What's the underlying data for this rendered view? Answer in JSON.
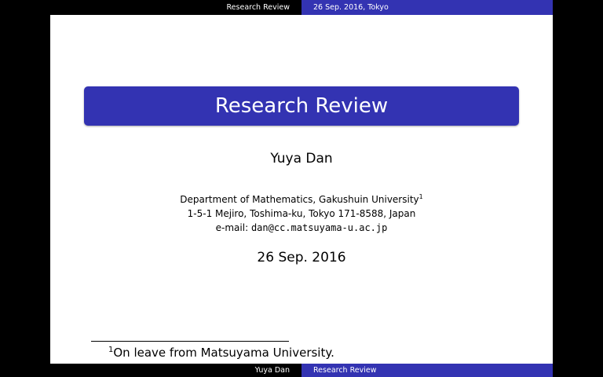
{
  "header": {
    "left_text": "Research Review",
    "right_text": "26 Sep. 2016, Tokyo"
  },
  "slide": {
    "title": "Research Review",
    "author": "Yuya Dan",
    "institute": {
      "line1": "Department of Mathematics, Gakushuin University",
      "line1_mark": "1",
      "line2": "1-5-1 Mejiro, Toshima-ku, Tokyo 171-8588, Japan",
      "email_label": "e-mail:",
      "email": "dan@cc.matsuyama-u.ac.jp"
    },
    "date": "26 Sep. 2016",
    "footnote": {
      "mark": "1",
      "text": "On leave from Matsuyama University."
    }
  },
  "footer": {
    "left_text": "Yuya Dan",
    "right_text": "Research Review"
  },
  "colors": {
    "accent": "#3333b2",
    "letterbox": "#000000",
    "slide_background": "#ffffff"
  }
}
